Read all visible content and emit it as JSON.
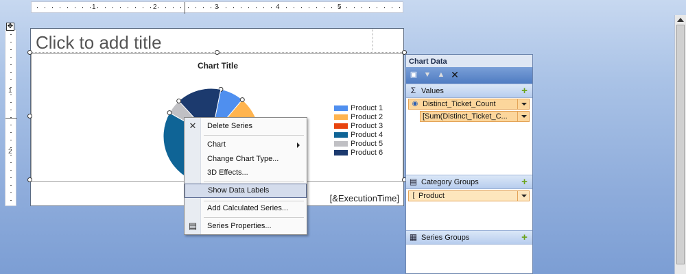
{
  "ruler": {
    "top_numbers": [
      "1",
      "2",
      "3",
      "4",
      "5"
    ],
    "left_numbers": [
      "1",
      "2"
    ]
  },
  "report": {
    "title_placeholder": "Click to add title",
    "execution_time": "[&ExecutionTime]"
  },
  "chart_data": {
    "type": "pie",
    "title": "Chart Title",
    "categories": [
      "Product 1",
      "Product 2",
      "Product 3",
      "Product 4",
      "Product 5",
      "Product 6"
    ],
    "values": [
      8,
      23,
      20,
      29,
      5,
      15
    ],
    "colors": [
      "#4f8fef",
      "#ffb44f",
      "#e8440f",
      "#0f6496",
      "#c0c0c4",
      "#1c3a6e"
    ],
    "legend_position": "right"
  },
  "context_menu": {
    "items": [
      {
        "label": "Delete Series",
        "icon": "delete-icon"
      },
      {
        "label": "Chart",
        "submenu": true
      },
      {
        "label": "Change Chart Type..."
      },
      {
        "label": "3D Effects..."
      },
      {
        "label": "Show Data Labels",
        "highlighted": true
      },
      {
        "label": "Add Calculated Series..."
      },
      {
        "label": "Series Properties...",
        "icon": "properties-icon"
      }
    ]
  },
  "chart_panel": {
    "title": "Chart Data",
    "values_header": "Values",
    "values_field": "Distinct_Ticket_Count",
    "values_subfield": "[Sum(Distinct_Ticket_C...",
    "category_header": "Category Groups",
    "category_field": "Product",
    "series_header": "Series Groups"
  }
}
